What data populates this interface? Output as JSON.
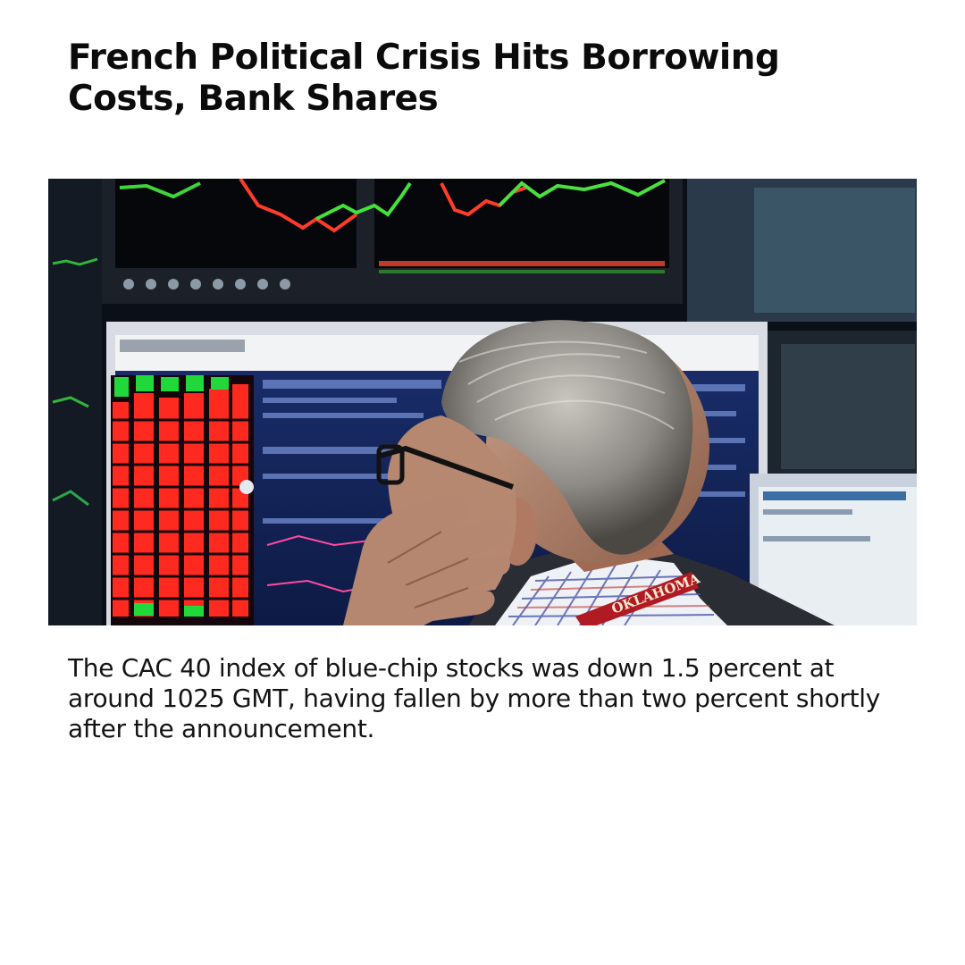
{
  "article": {
    "headline": "French Political Crisis Hits Borrowing Costs, Bank Shares",
    "caption": "The CAC 40 index of blue-chip stocks was down 1.5 percent at around 1025 GMT, having fallen by more than two percent shortly after the announcement.",
    "photo": {
      "subject": "trader-at-screens",
      "lanyard_text": "OKLAHOMA"
    }
  }
}
